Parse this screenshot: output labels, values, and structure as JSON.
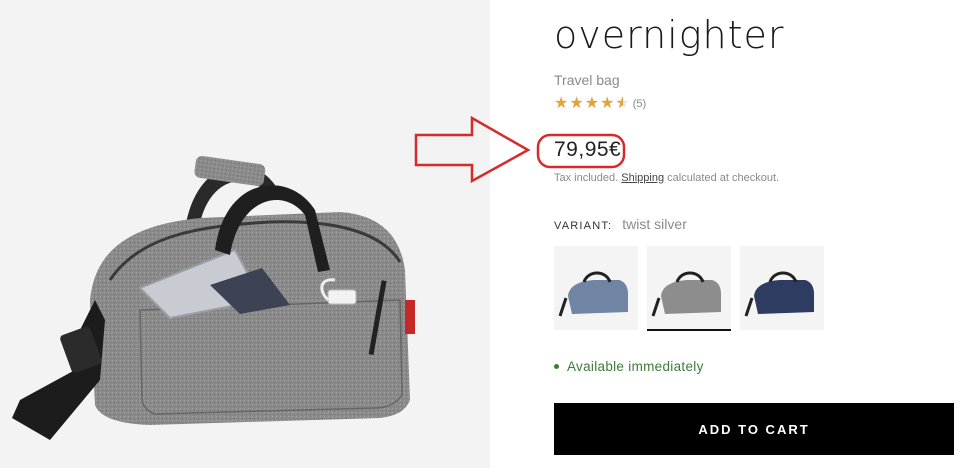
{
  "product": {
    "title": "overnighter",
    "subtitle": "Travel bag",
    "rating": {
      "value": 4.5,
      "max": 5,
      "count_label": "(5)"
    },
    "price": "79,95€",
    "tax_prefix": "Tax included.",
    "tax_link": "Shipping",
    "tax_suffix": "calculated at checkout."
  },
  "variant": {
    "label": "VARIANT:",
    "selected": "twist silver",
    "options": [
      {
        "name": "blue",
        "color": "#6f85a3"
      },
      {
        "name": "twist silver",
        "color": "#8d8d8d"
      },
      {
        "name": "navy",
        "color": "#2f3c61"
      }
    ]
  },
  "availability": {
    "text": "Available immediately",
    "color": "#3d7a3d"
  },
  "actions": {
    "add_to_cart": "ADD TO CART"
  },
  "annotation": {
    "color": "#d62b2b"
  }
}
